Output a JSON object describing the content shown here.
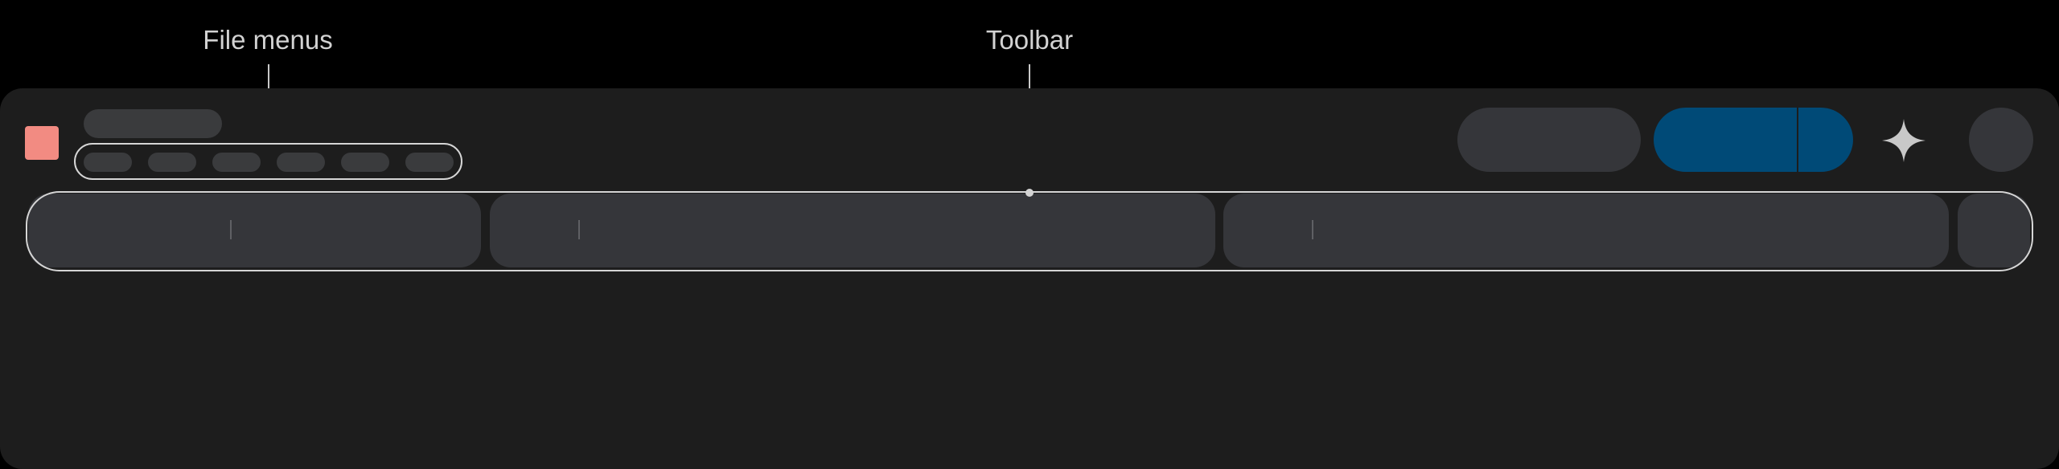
{
  "labels": {
    "file_menus": "File menus",
    "toolbar": "Toolbar"
  },
  "colors": {
    "background": "#000000",
    "window": "#1d1d1d",
    "placeholder": "#35363a",
    "primary_button": "#004a77",
    "app_icon": "#f28b82",
    "annotation": "#d6d6d6"
  },
  "icons": {
    "app": "app-icon",
    "assistant": "sparkle-icon",
    "account": "avatar"
  }
}
